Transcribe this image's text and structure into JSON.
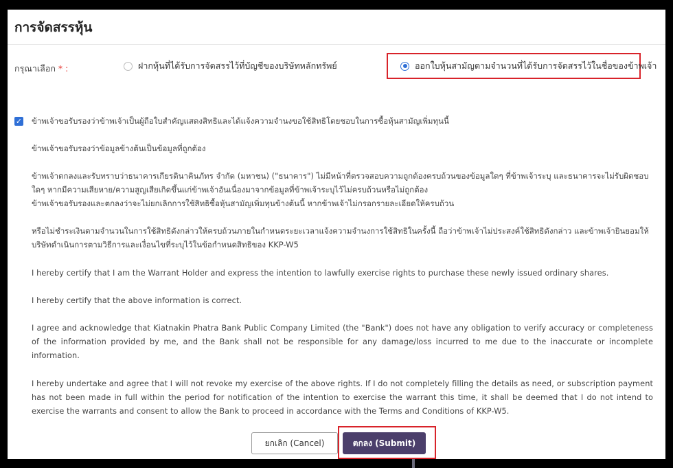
{
  "page": {
    "title": "การจัดสรรหุ้น"
  },
  "form": {
    "select_label": "กรุณาเลือก",
    "required_mark": "* :",
    "options": [
      {
        "label": "ฝากหุ้นที่ได้รับการจัดสรรไว้ที่บัญชีของบริษัทหลักทรัพย์",
        "selected": false
      },
      {
        "label": "ออกใบหุ้นสามัญตามจำนวนที่ได้รับการจัดสรรไว้ในชื่อของข้าพเจ้า",
        "selected": true
      }
    ]
  },
  "certification": {
    "checked": true,
    "check_mark": "✓",
    "paragraphs": [
      "ข้าพเจ้าขอรับรองว่าข้าพเจ้าเป็นผู้ถือใบสำคัญแสดงสิทธิและได้แจ้งความจำนงขอใช้สิทธิโดยชอบในการซื้อหุ้นสามัญเพิ่มทุนนี้",
      "ข้าพเจ้าขอรับรองว่าข้อมูลข้างต้นเป็นข้อมูลที่ถูกต้อง",
      "ข้าพเจ้าตกลงและรับทราบว่าธนาคารเกียรตินาคินภัทร จำกัด (มหาชน) (\"ธนาคาร\") ไม่มีหน้าที่ตรวจสอบความถูกต้องครบถ้วนของข้อมูลใดๆ ที่ข้าพเจ้าระบุ และธนาคารจะไม่รับผิดชอบใดๆ หากมีความเสียหาย/ความสูญเสียเกิดขึ้นแก่ข้าพเจ้าอันเนื่องมาจากข้อมูลที่ข้าพเจ้าระบุไว้ไม่ครบถ้วนหรือไม่ถูกต้อง",
      "ข้าพเจ้าขอรับรองและตกลงว่าจะไม่ยกเลิกการใช้สิทธิซื้อหุ้นสามัญเพิ่มทุนข้างต้นนี้ หากข้าพเจ้าไม่กรอกรายละเอียดให้ครบถ้วน",
      "หรือไม่ชำระเงินตามจำนวนในการใช้สิทธิดังกล่าวให้ครบถ้วนภายในกำหนดระยะเวลาแจ้งความจำนงการใช้สิทธิในครั้งนี้ ถือว่าข้าพเจ้าไม่ประสงค์ใช้สิทธิดังกล่าว และข้าพเจ้ายินยอมให้บริษัทดำเนินการตามวิธีการและเงื่อนไขที่ระบุไว้ในข้อกำหนดสิทธิของ KKP-W5",
      "I hereby certify that I am the Warrant Holder and express the intention to lawfully exercise rights to purchase these newly issued ordinary shares.",
      "I hereby certify that the above information is correct.",
      "I agree and acknowledge that Kiatnakin Phatra Bank Public Company Limited (the \"Bank\") does not have any obligation to verify accuracy or completeness of the information provided by me, and the Bank shall not be responsible for any damage/loss incurred to me due to the inaccurate or incomplete information.",
      "I hereby undertake and agree that I will not revoke my exercise of the above rights. If I do not completely filling the details as need, or subscription payment has not been made in full within the period for notification of the intention to exercise the warrant this time, it shall be deemed that I do not intend to exercise the warrants and consent to allow the Bank to proceed in accordance with the Terms and Conditions of KKP-W5."
    ]
  },
  "actions": {
    "cancel_label": "ยกเลิก (Cancel)",
    "submit_label": "ตกลง (Submit)"
  },
  "colors": {
    "accent": "#2f6fd6",
    "submit_bg": "#4b3f6b",
    "highlight": "#d8232a"
  }
}
